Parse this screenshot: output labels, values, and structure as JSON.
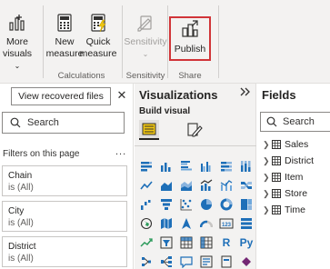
{
  "ribbon": {
    "buttons": {
      "more_visuals": {
        "line1": "More",
        "line2": "visuals",
        "icon": "more-visuals-icon"
      },
      "new_measure": {
        "line1": "New",
        "line2": "measure",
        "icon": "calculator-icon"
      },
      "quick_measure": {
        "line1": "Quick",
        "line2": "measure",
        "icon": "quick-measure-calculator-icon"
      },
      "sensitivity": {
        "line1": "Sensitivity",
        "icon": "sensitivity-icon",
        "disabled": true
      },
      "publish": {
        "line1": "Publish",
        "icon": "publish-icon",
        "highlighted": true
      }
    },
    "groups": {
      "calculations": "Calculations",
      "sensitivity": "Sensitivity",
      "share": "Share"
    },
    "colors": {
      "highlight_border": "#d13438"
    }
  },
  "filters": {
    "recover_button": "View recovered files",
    "close_glyph": "✕",
    "search_placeholder": "Search",
    "section_title": "Filters on this page",
    "more_glyph": "...",
    "cards": [
      {
        "name": "Chain",
        "value": "is (All)"
      },
      {
        "name": "City",
        "value": "is (All)"
      },
      {
        "name": "District",
        "value": "is (All)"
      }
    ]
  },
  "visualizations": {
    "title": "Visualizations",
    "collapse_glyph": "❯❯",
    "build_label": "Build visual",
    "text_icons": {
      "r_visual": "R",
      "python_visual": "Py"
    }
  },
  "fields": {
    "title": "Fields",
    "search_placeholder": "Search",
    "tables": [
      "Sales",
      "District",
      "Item",
      "Store",
      "Time"
    ]
  }
}
